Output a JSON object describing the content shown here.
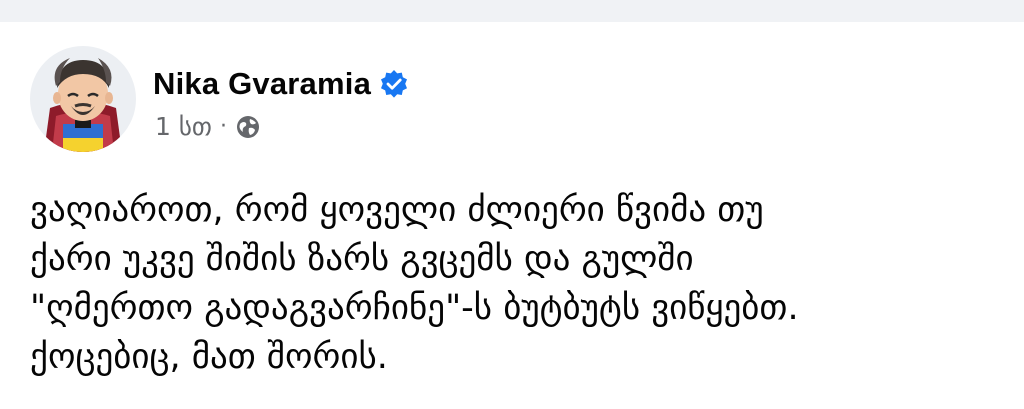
{
  "post": {
    "author": "Nika Gvaramia",
    "verified": true,
    "time": "1 სთ",
    "separator": "·",
    "privacy_icon": "globe-icon",
    "body": "ვაღიაროთ, რომ ყოველი ძლიერი წვიმა თუ\nქარი უკვე შიშის ზარს გვცემს და გულში\n\"ღმერთო გადაგვარჩინე\"-ს ბუტბუტს ვიწყებთ.\nქოცებიც, მათ შორის."
  },
  "colors": {
    "background": "#ffffff",
    "top_strip": "#f0f2f5",
    "name": "#050505",
    "meta": "#65676b",
    "verified_badge": "#1877f2"
  }
}
